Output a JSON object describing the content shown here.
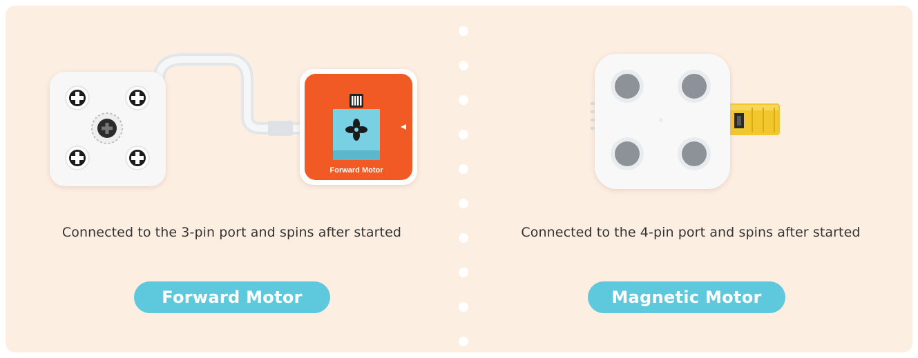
{
  "forward": {
    "caption": "Connected to the 3-pin port and spins after started",
    "button_label": "Forward Motor",
    "device_label": "Forward Motor",
    "device_color": "#f15a24",
    "device_panel_color": "#79d0e2"
  },
  "magnetic": {
    "caption": "Connected to the 4-pin port and spins after started",
    "button_label": "Magnetic Motor",
    "connector_color": "#f2c62d"
  },
  "colors": {
    "background": "#fdeee2",
    "accent": "#5ec9dc"
  },
  "icons": {
    "separator": "dotted-divider",
    "module_holes": "cross-hole-icon",
    "motor_symbol": "fan-icon"
  }
}
